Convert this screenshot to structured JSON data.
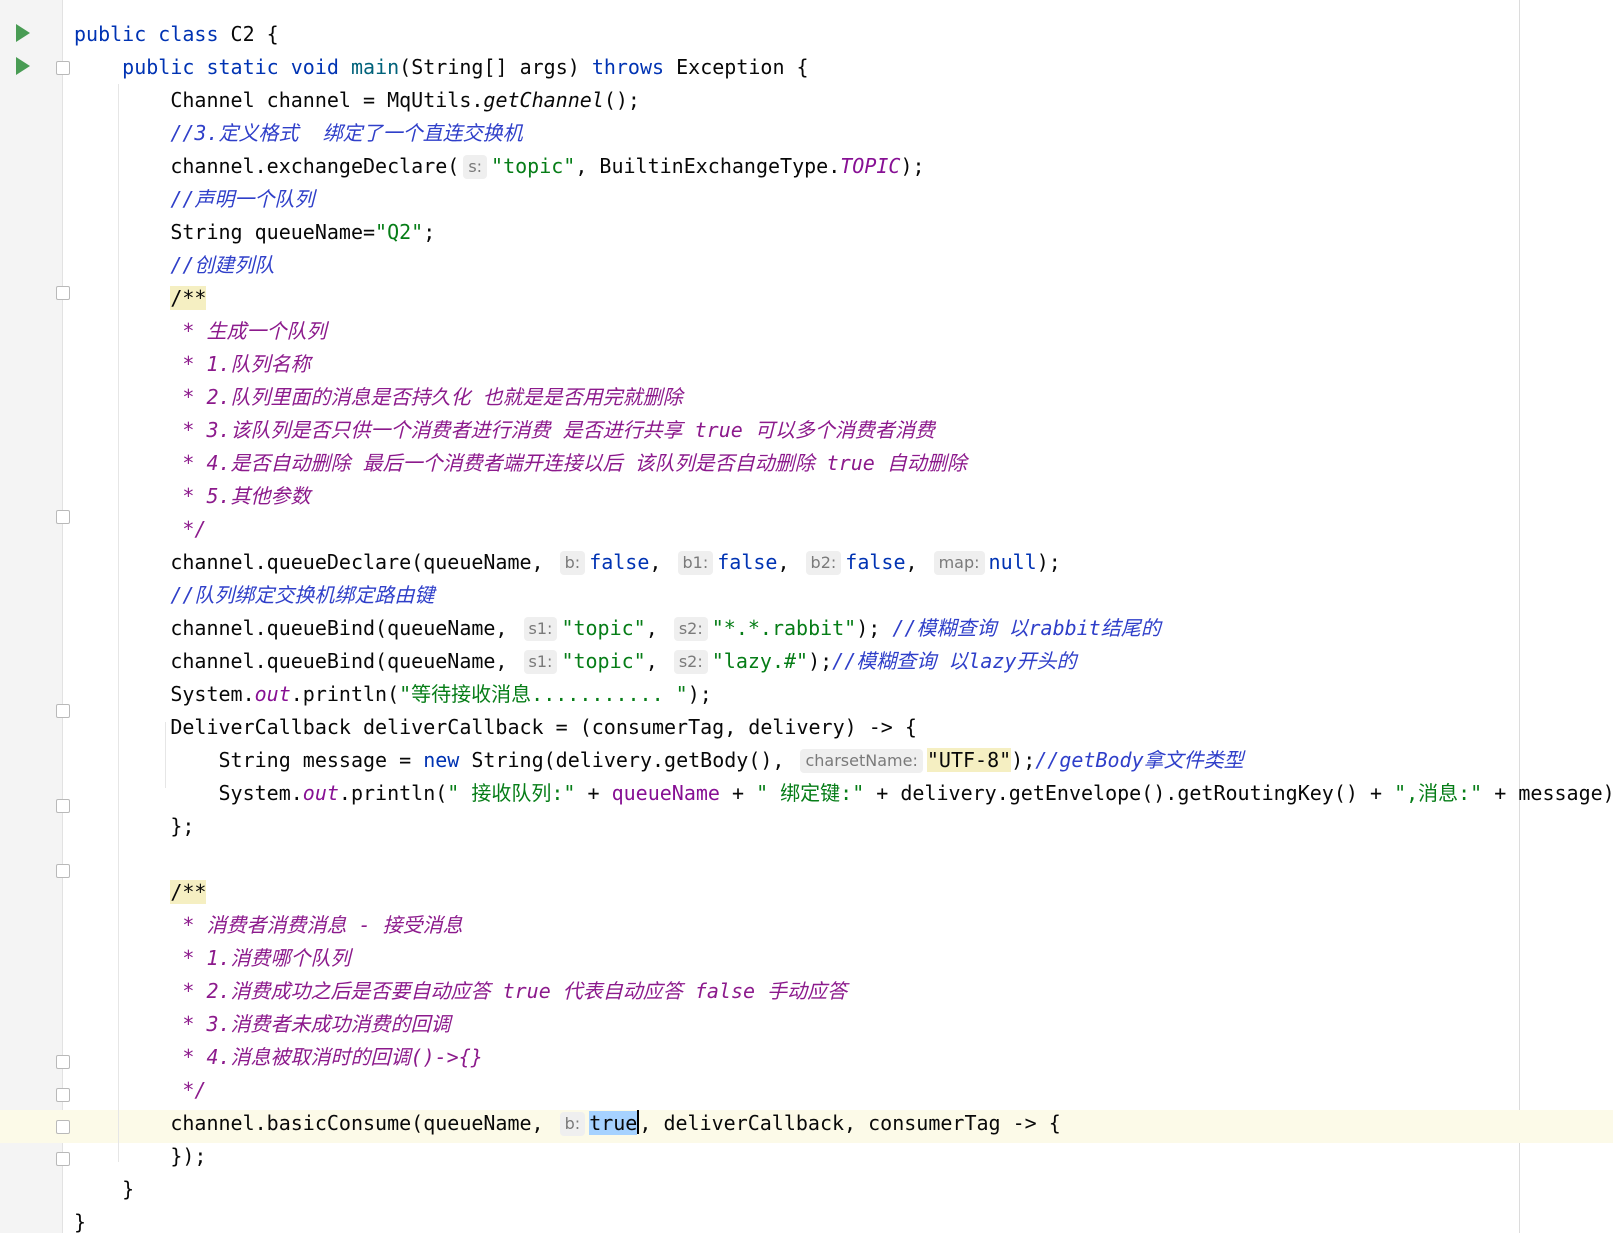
{
  "editor": {
    "lines": [
      [
        [
          "kw",
          "public "
        ],
        [
          "kw",
          "class "
        ],
        [
          "",
          "C2 {"
        ]
      ],
      [
        [
          "",
          "    "
        ],
        [
          "kw",
          "public "
        ],
        [
          "kw",
          "static "
        ],
        [
          "kw",
          "void "
        ],
        [
          "fn",
          "main"
        ],
        [
          "",
          "(String[] args) "
        ],
        [
          "kw",
          "throws "
        ],
        [
          "",
          "Exception {"
        ]
      ],
      [
        [
          "",
          "        Channel channel = MqUtils."
        ],
        [
          "italic",
          "getChannel"
        ],
        [
          "",
          "();"
        ]
      ],
      [
        [
          "",
          "        "
        ],
        [
          "cmt",
          "//3.定义格式  绑定了一个直连交换机"
        ]
      ],
      [
        [
          "",
          "        channel.exchangeDeclare("
        ],
        [
          "hint",
          "s:"
        ],
        [
          "str",
          "\"topic\""
        ],
        [
          "",
          ", BuiltinExchangeType."
        ],
        [
          "static",
          "TOPIC"
        ],
        [
          "",
          ");"
        ]
      ],
      [
        [
          "",
          "        "
        ],
        [
          "cmt",
          "//声明一个队列"
        ]
      ],
      [
        [
          "",
          "        String queueName="
        ],
        [
          "str",
          "\"Q2\""
        ],
        [
          "",
          ";"
        ]
      ],
      [
        [
          "",
          "        "
        ],
        [
          "cmt",
          "//创建列队"
        ]
      ],
      [
        [
          "",
          "        "
        ],
        [
          "doc-open",
          "/**"
        ]
      ],
      [
        [
          "",
          "        "
        ],
        [
          "doc",
          " * 生成一个队列"
        ]
      ],
      [
        [
          "",
          "        "
        ],
        [
          "doc",
          " * 1.队列名称"
        ]
      ],
      [
        [
          "",
          "        "
        ],
        [
          "doc",
          " * 2.队列里面的消息是否持久化 也就是是否用完就删除"
        ]
      ],
      [
        [
          "",
          "        "
        ],
        [
          "doc",
          " * 3.该队列是否只供一个消费者进行消费 是否进行共享 true 可以多个消费者消费"
        ]
      ],
      [
        [
          "",
          "        "
        ],
        [
          "doc",
          " * 4.是否自动删除 最后一个消费者端开连接以后 该队列是否自动删除 true 自动删除"
        ]
      ],
      [
        [
          "",
          "        "
        ],
        [
          "doc",
          " * 5.其他参数"
        ]
      ],
      [
        [
          "",
          "        "
        ],
        [
          "doc",
          " */"
        ]
      ],
      [
        [
          "",
          "        channel.queueDeclare(queueName, "
        ],
        [
          "hint",
          "b:"
        ],
        [
          "kw",
          "false"
        ],
        [
          "",
          ", "
        ],
        [
          "hint",
          "b1:"
        ],
        [
          "kw",
          "false"
        ],
        [
          "",
          ", "
        ],
        [
          "hint",
          "b2:"
        ],
        [
          "kw",
          "false"
        ],
        [
          "",
          ", "
        ],
        [
          "hint",
          "map:"
        ],
        [
          "kw",
          "null"
        ],
        [
          "",
          ");"
        ]
      ],
      [
        [
          "",
          "        "
        ],
        [
          "cmt",
          "//队列绑定交换机绑定路由键"
        ]
      ],
      [
        [
          "",
          "        channel.queueBind(queueName, "
        ],
        [
          "hint",
          "s1:"
        ],
        [
          "str",
          "\"topic\""
        ],
        [
          "",
          ", "
        ],
        [
          "hint",
          "s2:"
        ],
        [
          "str",
          "\"*.*.rabbit\""
        ],
        [
          "",
          "); "
        ],
        [
          "cmt",
          "//模糊查询 以rabbit结尾的"
        ]
      ],
      [
        [
          "",
          "        channel.queueBind(queueName, "
        ],
        [
          "hint",
          "s1:"
        ],
        [
          "str",
          "\"topic\""
        ],
        [
          "",
          ", "
        ],
        [
          "hint",
          "s2:"
        ],
        [
          "str",
          "\"lazy.#\""
        ],
        [
          "",
          ");"
        ],
        [
          "cmt",
          "//模糊查询 以lazy开头的"
        ]
      ],
      [
        [
          "",
          "        System."
        ],
        [
          "static",
          "out"
        ],
        [
          "",
          ".println("
        ],
        [
          "str",
          "\"等待接收消息........... \""
        ],
        [
          "",
          ");"
        ]
      ],
      [
        [
          "",
          "        DeliverCallback deliverCallback = (consumerTag, delivery) -> {"
        ]
      ],
      [
        [
          "",
          "            String message = "
        ],
        [
          "kw",
          "new "
        ],
        [
          "",
          "String(delivery.getBody(), "
        ],
        [
          "hint",
          "charsetName:"
        ],
        [
          "hl-str",
          "\"UTF-8\""
        ],
        [
          "",
          ");"
        ],
        [
          "cmt",
          "//getBody拿文件类型"
        ]
      ],
      [
        [
          "",
          "            System."
        ],
        [
          "static",
          "out"
        ],
        [
          "",
          ".println("
        ],
        [
          "str",
          "\" 接收队列:\""
        ],
        [
          "",
          " + "
        ],
        [
          "param",
          "queueName"
        ],
        [
          "",
          " + "
        ],
        [
          "str",
          "\" 绑定键:\""
        ],
        [
          "",
          " + delivery.getEnvelope().getRoutingKey() + "
        ],
        [
          "str",
          "\",消息:\""
        ],
        [
          "",
          " + message);"
        ]
      ],
      [
        [
          "",
          "        };"
        ]
      ],
      [
        [
          "",
          ""
        ]
      ],
      [
        [
          "",
          "        "
        ],
        [
          "doc-open",
          "/**"
        ]
      ],
      [
        [
          "",
          "        "
        ],
        [
          "doc",
          " * 消费者消费消息 - 接受消息"
        ]
      ],
      [
        [
          "",
          "        "
        ],
        [
          "doc",
          " * 1.消费哪个队列"
        ]
      ],
      [
        [
          "",
          "        "
        ],
        [
          "doc",
          " * 2.消费成功之后是否要自动应答 true 代表自动应答 false 手动应答"
        ]
      ],
      [
        [
          "",
          "        "
        ],
        [
          "doc",
          " * 3.消费者未成功消费的回调"
        ]
      ],
      [
        [
          "",
          "        "
        ],
        [
          "doc",
          " * 4.消息被取消时的回调()->{}"
        ]
      ],
      [
        [
          "",
          "        "
        ],
        [
          "doc",
          " */"
        ]
      ],
      [
        [
          "",
          "        channel.basicConsume(queueName, "
        ],
        [
          "hint",
          "b:"
        ],
        [
          "selected",
          "true"
        ],
        [
          "caret",
          ""
        ],
        [
          "",
          ", deliverCallback, consumerTag -> {"
        ]
      ],
      [
        [
          "",
          "        });"
        ]
      ],
      [
        [
          "",
          "    }"
        ]
      ],
      [
        [
          "",
          "}"
        ]
      ]
    ]
  },
  "colors": {
    "keyword": "#0033b3",
    "string": "#067d17",
    "comment": "#2f3fc9",
    "doc_comment": "#8c1a8c",
    "static_field": "#871094",
    "run_icon": "#499c54"
  }
}
